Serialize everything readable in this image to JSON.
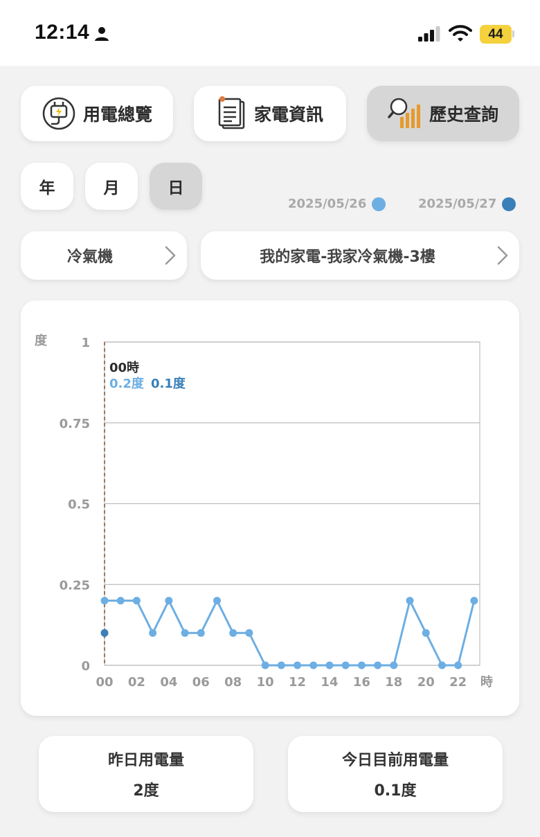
{
  "status_bar": {
    "time": "12:14",
    "battery": "44"
  },
  "nav": {
    "tabs": [
      {
        "label": "用電總覽",
        "icon": "plug-icon"
      },
      {
        "label": "家電資訊",
        "icon": "document-icon"
      },
      {
        "label": "歷史查詢",
        "icon": "history-search-icon",
        "active": true
      }
    ]
  },
  "period": {
    "options": [
      {
        "label": "年"
      },
      {
        "label": "月"
      },
      {
        "label": "日",
        "active": true
      }
    ]
  },
  "legend": {
    "items": [
      {
        "label": "2025/05/26",
        "color": "#6daee3"
      },
      {
        "label": "2025/05/27",
        "color": "#3a7fb8"
      }
    ]
  },
  "selectors": {
    "category": "冷氣機",
    "device": "我的家電-我家冷氣機-3樓"
  },
  "chart_data": {
    "type": "line",
    "y_unit": "度",
    "x_unit": "時",
    "ylim": [
      0,
      1
    ],
    "y_ticks": [
      "0",
      "0.25",
      "0.5",
      "0.75",
      "1"
    ],
    "x": [
      0,
      1,
      2,
      3,
      4,
      5,
      6,
      7,
      8,
      9,
      10,
      11,
      12,
      13,
      14,
      15,
      16,
      17,
      18,
      19,
      20,
      21,
      22,
      23
    ],
    "x_tick_labels": [
      "00",
      "02",
      "04",
      "06",
      "08",
      "10",
      "12",
      "14",
      "16",
      "18",
      "20",
      "22"
    ],
    "series": [
      {
        "name": "2025/05/26",
        "color": "#6daee3",
        "values": [
          0.2,
          0.2,
          0.2,
          0.1,
          0.2,
          0.1,
          0.1,
          0.2,
          0.1,
          0.1,
          0,
          0,
          0,
          0,
          0,
          0,
          0,
          0,
          0,
          0.2,
          0.1,
          0,
          0,
          0.2
        ]
      },
      {
        "name": "2025/05/27",
        "color": "#3a7fb8",
        "values": [
          0.1
        ]
      }
    ],
    "cursor": {
      "x": 0,
      "hour_label": "00時",
      "value_prev": "0.2度",
      "value_curr": "0.1度"
    }
  },
  "stats": {
    "yesterday_label": "昨日用電量",
    "yesterday_value": "2度",
    "today_label": "今日目前用電量",
    "today_value": "0.1度"
  }
}
